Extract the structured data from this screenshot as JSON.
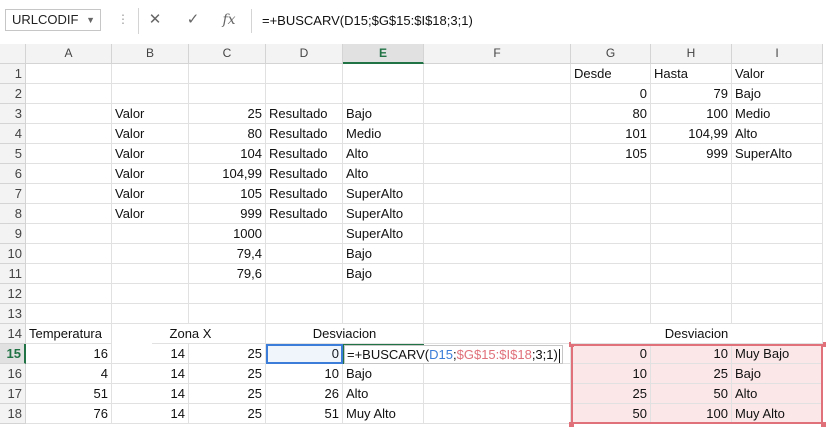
{
  "name_box": "URLCODIF",
  "formula_bar": "=+BUSCARV(D15;$G$15:$I$18;3;1)",
  "toolbar": {
    "cancel": "✕",
    "enter": "✓",
    "fx": "fx",
    "dots": "⋮"
  },
  "columns": [
    "A",
    "B",
    "C",
    "D",
    "E",
    "F",
    "G",
    "H",
    "I"
  ],
  "rows": [
    "1",
    "2",
    "3",
    "4",
    "5",
    "6",
    "7",
    "8",
    "9",
    "10",
    "11",
    "12",
    "13",
    "14",
    "15",
    "16",
    "17",
    "18"
  ],
  "cells": {
    "G1": "Desde",
    "H1": "Hasta",
    "I1": "Valor",
    "G2": "0",
    "H2": "79",
    "I2": "Bajo",
    "B3": "Valor",
    "C3": "25",
    "D3": "Resultado",
    "E3": "Bajo",
    "G3": "80",
    "H3": "100",
    "I3": "Medio",
    "B4": "Valor",
    "C4": "80",
    "D4": "Resultado",
    "E4": "Medio",
    "G4": "101",
    "H4": "104,99",
    "I4": "Alto",
    "B5": "Valor",
    "C5": "104",
    "D5": "Resultado",
    "E5": "Alto",
    "G5": "105",
    "H5": "999",
    "I5": "SuperAlto",
    "B6": "Valor",
    "C6": "104,99",
    "D6": "Resultado",
    "E6": "Alto",
    "B7": "Valor",
    "C7": "105",
    "D7": "Resultado",
    "E7": "SuperAlto",
    "B8": "Valor",
    "C8": "999",
    "D8": "Resultado",
    "E8": "SuperAlto",
    "C9": "1000",
    "E9": "SuperAlto",
    "C10": "79,4",
    "E10": "Bajo",
    "C11": "79,6",
    "E11": "Bajo",
    "A14": "Temperatura",
    "B14": "Zona X",
    "D14": "Desviacion",
    "G14": "Desviacion",
    "A15": "16",
    "B15": "14",
    "C15": "25",
    "D15": "0",
    "G15": "0",
    "H15": "10",
    "I15": "Muy Bajo",
    "A16": "4",
    "B16": "14",
    "C16": "25",
    "D16": "10",
    "E16": "Bajo",
    "G16": "10",
    "H16": "25",
    "I16": "Bajo",
    "A17": "51",
    "B17": "14",
    "C17": "25",
    "D17": "26",
    "E17": "Alto",
    "G17": "25",
    "H17": "50",
    "I17": "Alto",
    "A18": "76",
    "B18": "14",
    "C18": "25",
    "D18": "51",
    "E18": "Muy Alto",
    "G18": "50",
    "H18": "100",
    "I18": "Muy Alto"
  },
  "editor": {
    "prefix": "=+BUSCARV(",
    "ref1": "D15",
    "sep": ";",
    "ref2": "$G$15:$I$18",
    "suffix": ";3;1)"
  },
  "active_cell": "E15",
  "colors": {
    "accent": "#217346",
    "range_blue": "#3b7dd8",
    "range_red": "#e0707a",
    "range_fill": "#fbe7e8"
  }
}
